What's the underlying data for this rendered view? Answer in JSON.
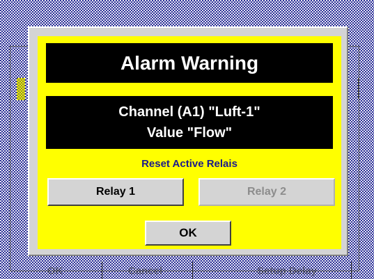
{
  "background": {
    "footer_items": [
      "OK",
      "Cancel",
      "Setup Delay"
    ]
  },
  "dialog": {
    "title": "Alarm Warning",
    "message_line1": "Channel (A1) \"Luft-1\"",
    "message_line2": "Value \"Flow\"",
    "reset_label": "Reset Active Relais",
    "relay1_label": "Relay 1",
    "relay2_label": "Relay 2",
    "relay2_enabled": false,
    "ok_label": "OK"
  },
  "colors": {
    "dialog_background": "#ffff00",
    "title_background": "#000000",
    "reset_label_color": "#1a1a8c"
  }
}
